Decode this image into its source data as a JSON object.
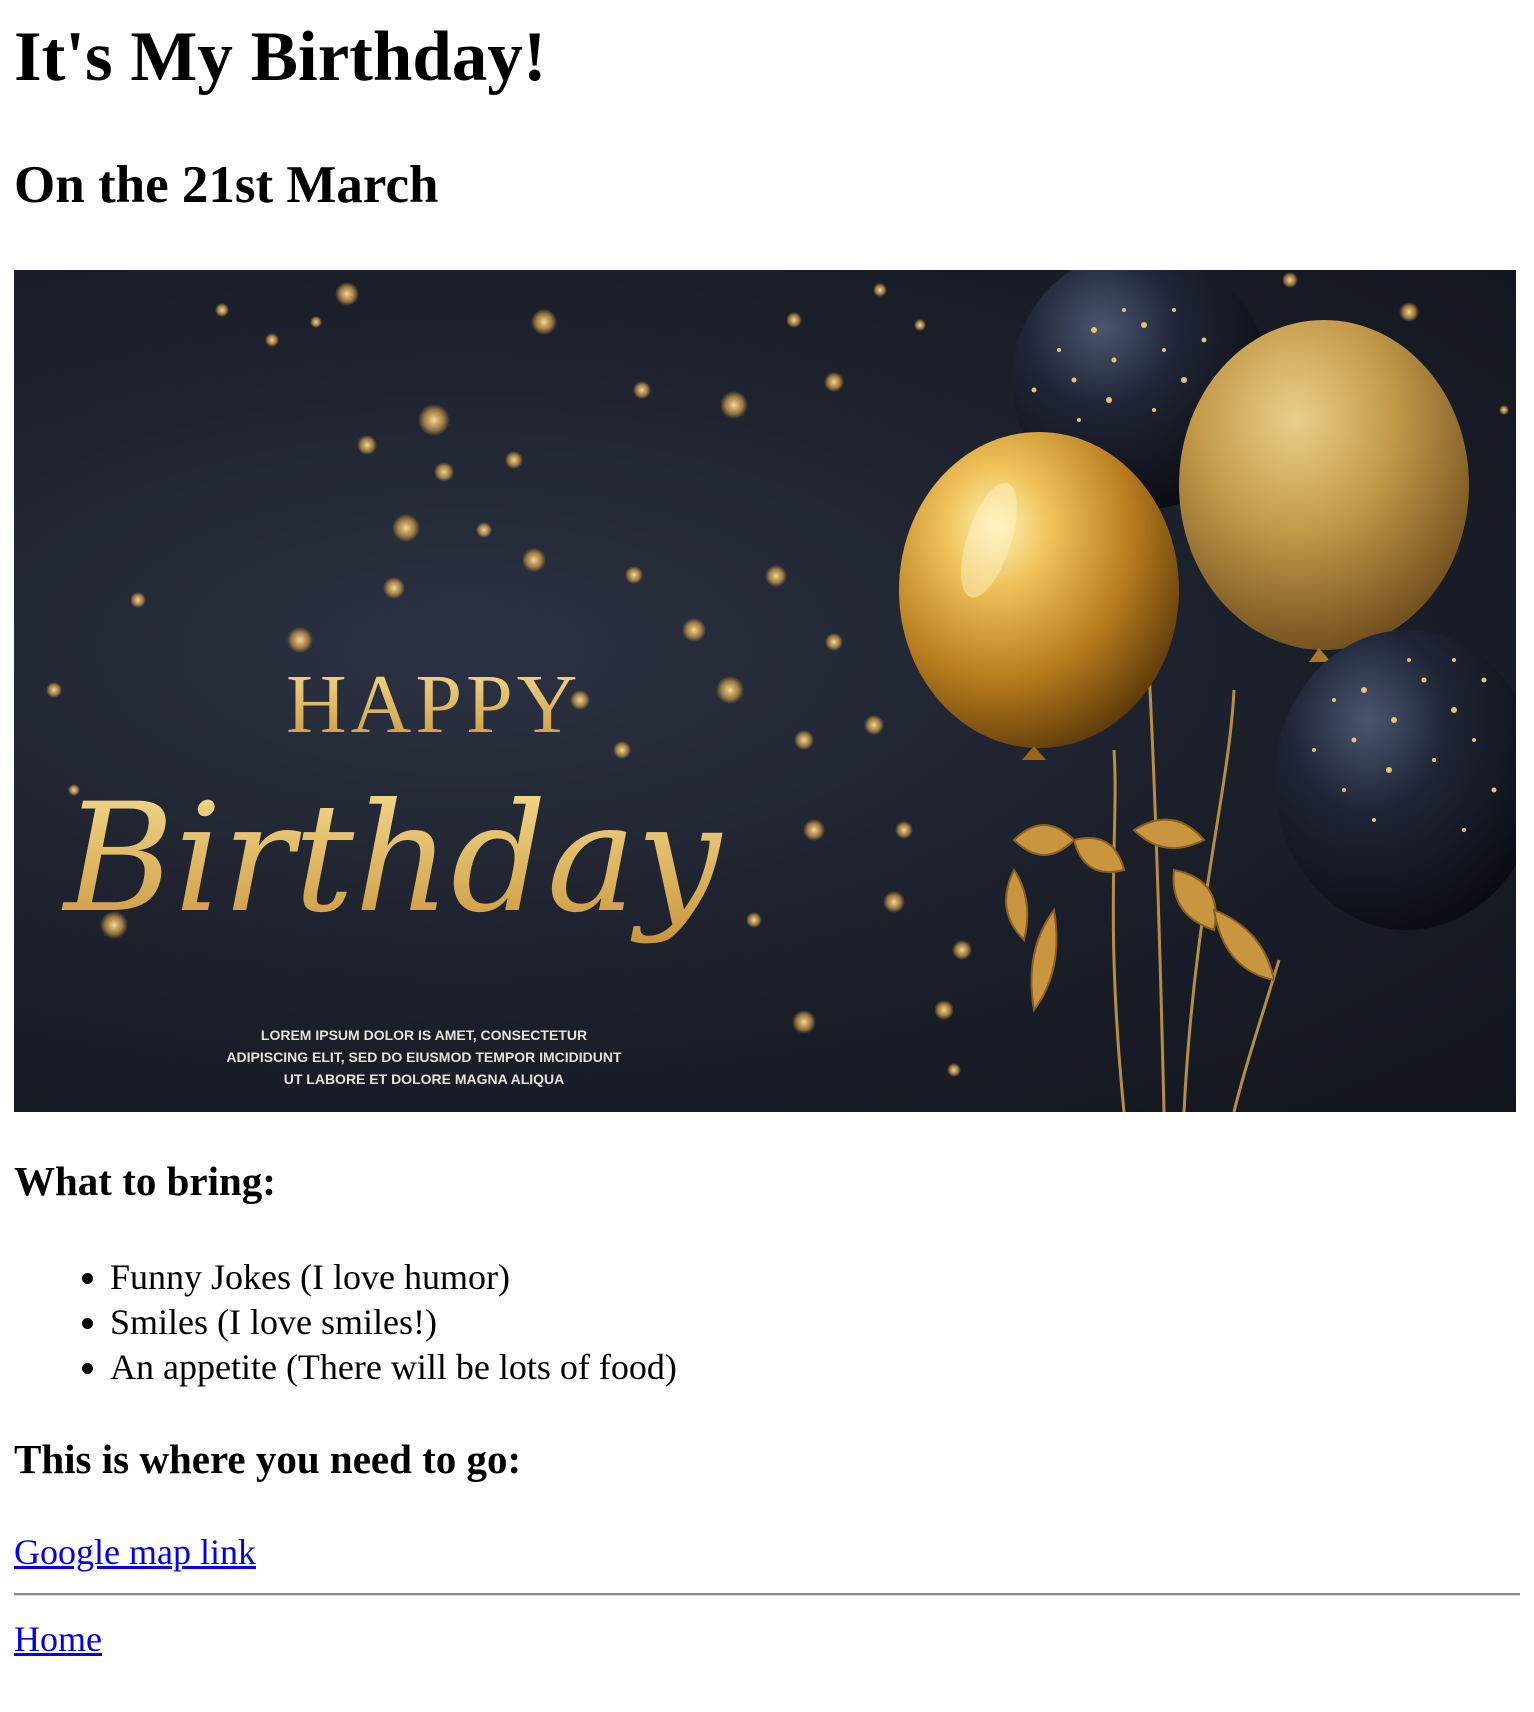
{
  "page": {
    "title": "It's My Birthday!",
    "date_heading": "On the 21st March"
  },
  "banner": {
    "happy_text": "HAPPY",
    "birthday_text": "Birthday",
    "fine_print": [
      "LOREM IPSUM DOLOR IS AMET, CONSECTETUR",
      "ADIPISCING ELIT, SED DO EIUSMOD TEMPOR IMCIDIDUNT",
      "UT LABORE ET DOLORE MAGNA ALIQUA"
    ],
    "colors": {
      "gold": "#d4a64a",
      "gold_light": "#f3d27c",
      "navy": "#1b1f2a"
    }
  },
  "bring": {
    "heading": "What to bring:",
    "items": [
      "Funny Jokes (I love humor)",
      "Smiles (I love smiles!)",
      "An appetite (There will be lots of food)"
    ]
  },
  "location": {
    "heading": "This is where you need to go:",
    "map_link_label": "Google map link"
  },
  "footer": {
    "home_link_label": "Home"
  },
  "colors": {
    "link": "#0000ee",
    "divider": "#8a8a8a"
  }
}
